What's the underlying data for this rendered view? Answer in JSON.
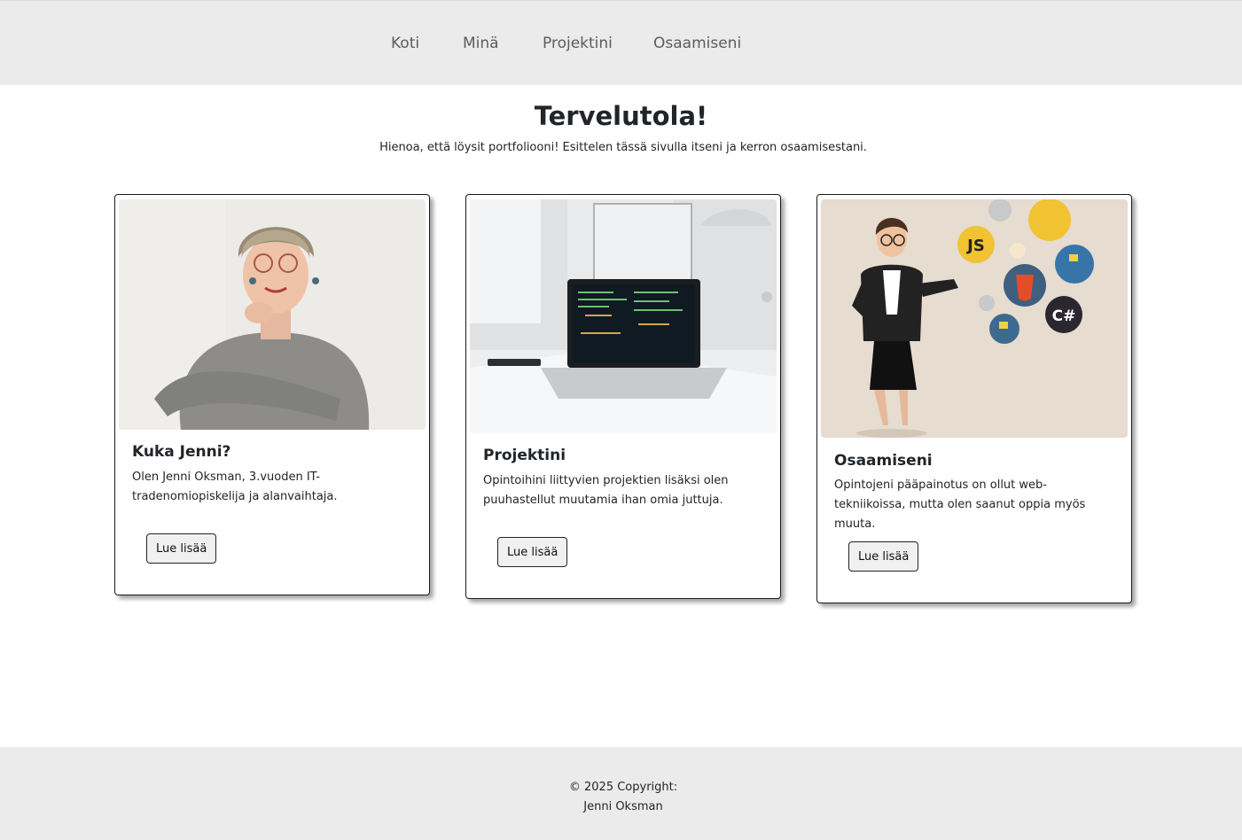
{
  "nav": {
    "items": [
      {
        "label": "Koti"
      },
      {
        "label": "Minä"
      },
      {
        "label": "Projektini"
      },
      {
        "label": "Osaamiseni"
      }
    ]
  },
  "hero": {
    "title": "Tervelutola!",
    "subtitle": "Hienoa, että löysit portfoliooni! Esittelen tässä sivulla itseni ja kerron osaamisestani."
  },
  "cards": [
    {
      "image": "portrait-photo",
      "title": "Kuka Jenni?",
      "text": "Olen Jenni Oksman, 3.vuoden IT-tradenomiopiskelija ja alanvaihtaja.",
      "button": "Lue lisää"
    },
    {
      "image": "laptop-photo",
      "title": "Projektini",
      "text": "Opintoihini liittyvien projektien lisäksi olen puuhastellut muutamia ihan omia juttuja.",
      "button": "Lue lisää"
    },
    {
      "image": "developer-illustration",
      "title": "Osaamiseni",
      "text": "Opintojeni pääpainotus on ollut web-tekniikoissa, mutta olen saanut oppia myös muuta.",
      "button": "Lue lisää",
      "badges": [
        "JS",
        "C#"
      ]
    }
  ],
  "footer": {
    "copyright": "© 2025 Copyright:",
    "name": "Jenni Oksman"
  },
  "colors": {
    "nav_bg": "#ebebeb",
    "footer_bg": "#ebebeb",
    "text": "#212529",
    "nav_text": "#5c5c5c"
  }
}
